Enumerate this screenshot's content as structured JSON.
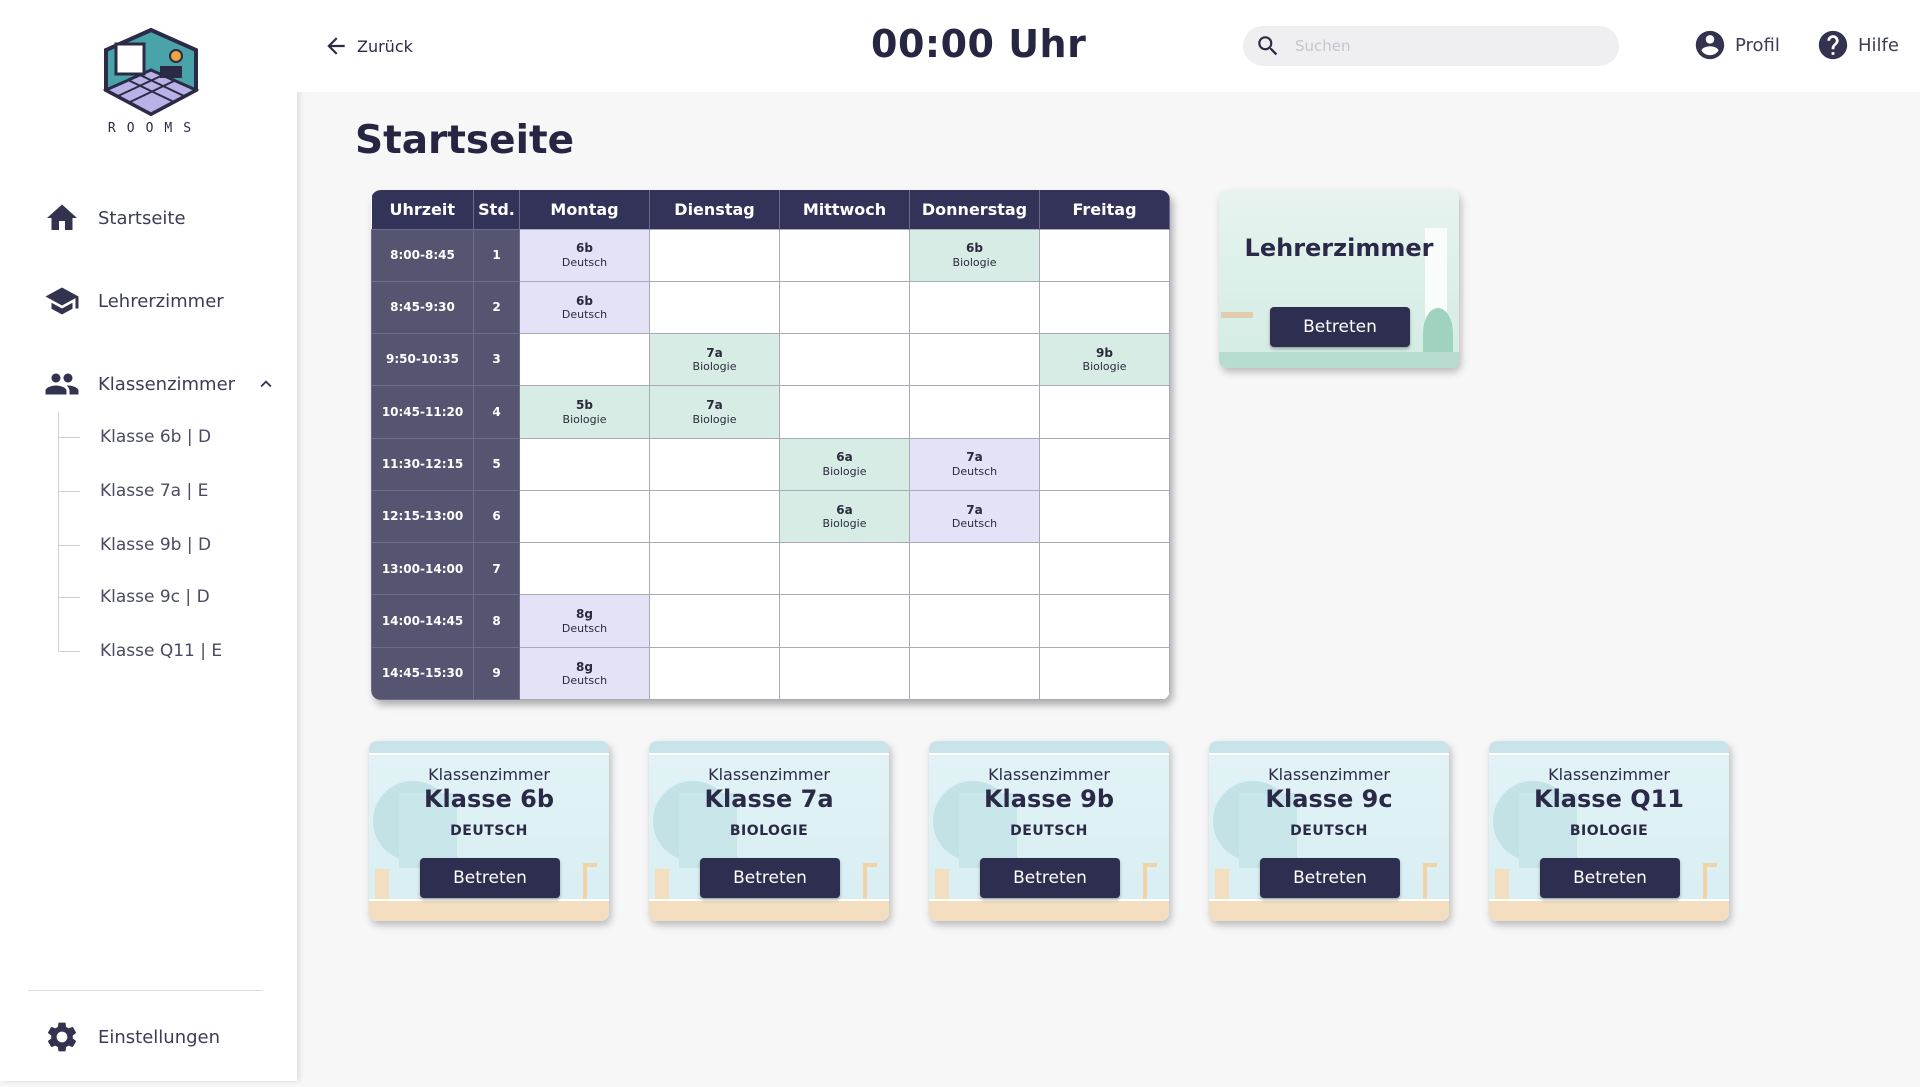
{
  "app": {
    "logo_text": "ROOMS"
  },
  "sidebar": {
    "items": [
      {
        "label": "Startseite",
        "icon": "home-icon"
      },
      {
        "label": "Lehrerzimmer",
        "icon": "graduation-cap-icon"
      },
      {
        "label": "Klassenzimmer",
        "icon": "people-icon"
      }
    ],
    "classes": [
      "Klasse 6b | D",
      "Klasse 7a | E",
      "Klasse 9b | D",
      "Klasse 9c | D",
      "Klasse Q11 | E"
    ],
    "settings_label": "Einstellungen"
  },
  "topbar": {
    "back_label": "Zurück",
    "clock": "00:00 Uhr",
    "search_placeholder": "Suchen",
    "profile_label": "Profil",
    "help_label": "Hilfe"
  },
  "main": {
    "title": "Startseite"
  },
  "timetable": {
    "headers": [
      "Uhrzeit",
      "Std.",
      "Montag",
      "Dienstag",
      "Mittwoch",
      "Donnerstag",
      "Freitag"
    ],
    "rows": [
      {
        "time": "8:00-8:45",
        "num": "1",
        "cells": [
          [
            "6b",
            "Deutsch"
          ],
          null,
          null,
          [
            "6b",
            "Biologie"
          ],
          null
        ]
      },
      {
        "time": "8:45-9:30",
        "num": "2",
        "cells": [
          [
            "6b",
            "Deutsch"
          ],
          null,
          null,
          null,
          null
        ]
      },
      {
        "time": "9:50-10:35",
        "num": "3",
        "cells": [
          null,
          [
            "7a",
            "Biologie"
          ],
          null,
          null,
          [
            "9b",
            "Biologie"
          ]
        ]
      },
      {
        "time": "10:45-11:20",
        "num": "4",
        "cells": [
          [
            "5b",
            "Biologie"
          ],
          [
            "7a",
            "Biologie"
          ],
          null,
          null,
          null
        ]
      },
      {
        "time": "11:30-12:15",
        "num": "5",
        "cells": [
          null,
          null,
          [
            "6a",
            "Biologie"
          ],
          [
            "7a",
            "Deutsch"
          ],
          null
        ]
      },
      {
        "time": "12:15-13:00",
        "num": "6",
        "cells": [
          null,
          null,
          [
            "6a",
            "Biologie"
          ],
          [
            "7a",
            "Deutsch"
          ],
          null
        ]
      },
      {
        "time": "13:00-14:00",
        "num": "7",
        "cells": [
          null,
          null,
          null,
          null,
          null
        ]
      },
      {
        "time": "14:00-14:45",
        "num": "8",
        "cells": [
          [
            "8g",
            "Deutsch"
          ],
          null,
          null,
          null,
          null
        ]
      },
      {
        "time": "14:45-15:30",
        "num": "9",
        "cells": [
          [
            "8g",
            "Deutsch"
          ],
          null,
          null,
          null,
          null
        ]
      }
    ],
    "colors": {
      "Deutsch": "#e4e2f6",
      "Biologie": "#d8ece6",
      "header": "#33335a",
      "side": "#555571"
    }
  },
  "lehrerzimmer_card": {
    "title": "Lehrerzimmer",
    "button": "Betreten"
  },
  "classroom_cards": [
    {
      "over": "Klassenzimmer",
      "title": "Klasse 6b",
      "subject": "DEUTSCH",
      "button": "Betreten"
    },
    {
      "over": "Klassenzimmer",
      "title": "Klasse 7a",
      "subject": "BIOLOGIE",
      "button": "Betreten"
    },
    {
      "over": "Klassenzimmer",
      "title": "Klasse 9b",
      "subject": "DEUTSCH",
      "button": "Betreten"
    },
    {
      "over": "Klassenzimmer",
      "title": "Klasse 9c",
      "subject": "DEUTSCH",
      "button": "Betreten"
    },
    {
      "over": "Klassenzimmer",
      "title": "Klasse Q11",
      "subject": "BIOLOGIE",
      "button": "Betreten"
    }
  ]
}
